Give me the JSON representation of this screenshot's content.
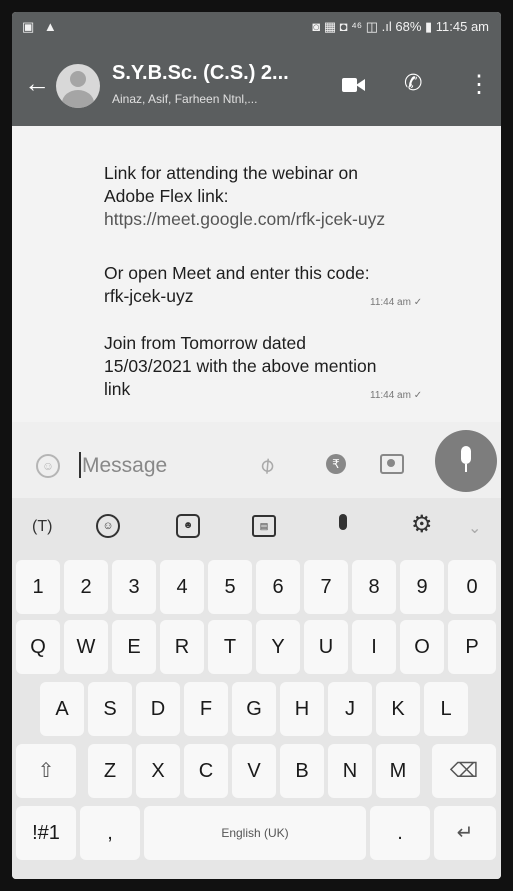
{
  "status_bar": {
    "left_icons": "▣ ▲",
    "right_text": "◙ ▦ ◘ ⁴⁶ ◫ .ıl 68% ▮ 11:45 am"
  },
  "header": {
    "chat_title": "S.Y.B.Sc. (C.S.) 2...",
    "chat_subtitle": "Ainaz, Asif, Farheen Ntnl,..."
  },
  "messages": [
    {
      "lines": [
        "Link for attending the webinar on",
        "Adobe Flex  link:"
      ],
      "link": "https://meet.google.com/rfk-jcek-uyz"
    },
    {
      "lines": [
        "Or open Meet and enter this code:",
        "rfk-jcek-uyz"
      ],
      "time": "11:44 am ✓"
    },
    {
      "lines": [
        "Join from Tomorrow dated",
        "15/03/2021 with the above mention",
        "link"
      ],
      "time": "11:44 am ✓"
    }
  ],
  "composer": {
    "placeholder": "Message"
  },
  "keyboard": {
    "toolbar_translate": "(T)",
    "row_numbers": [
      "1",
      "2",
      "3",
      "4",
      "5",
      "6",
      "7",
      "8",
      "9",
      "0"
    ],
    "row1": [
      "Q",
      "W",
      "E",
      "R",
      "T",
      "Y",
      "U",
      "I",
      "O",
      "P"
    ],
    "row2": [
      "A",
      "S",
      "D",
      "F",
      "G",
      "H",
      "J",
      "K",
      "L"
    ],
    "row3": [
      "Z",
      "X",
      "C",
      "V",
      "B",
      "N",
      "M"
    ],
    "symbols_key": "!#1",
    "comma_key": ",",
    "space_label": "English (UK)",
    "period_key": "."
  }
}
